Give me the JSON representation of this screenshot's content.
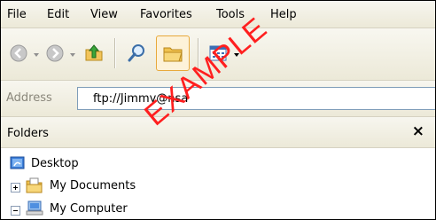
{
  "menubar": {
    "items": [
      "File",
      "Edit",
      "View",
      "Favorites",
      "Tools",
      "Help"
    ]
  },
  "toolbar": {
    "buttons": [
      {
        "icon": "back-arrow-icon"
      },
      {
        "icon": "forward-arrow-icon"
      },
      {
        "icon": "up-folder-icon"
      },
      {
        "icon": "search-icon"
      },
      {
        "icon": "folders-icon",
        "active": true
      },
      {
        "icon": "views-icon"
      }
    ]
  },
  "address": {
    "label": "Address",
    "value": "ftp://Jimmy@nsa"
  },
  "folders": {
    "title": "Folders",
    "close_glyph": "×",
    "tree": [
      {
        "label": "Desktop",
        "icon": "desktop-icon"
      },
      {
        "label": "My Documents",
        "icon": "my-documents-icon",
        "expander": "plus"
      },
      {
        "label": "My Computer",
        "icon": "my-computer-icon",
        "expander": "minus"
      }
    ]
  },
  "watermark": {
    "text": "EXAMPLE",
    "color": "#ff1f1f"
  },
  "colors": {
    "toolbar_bg": "#ece9d8",
    "field_border": "#7f9db9",
    "active_button_border": "#e8a93c"
  }
}
